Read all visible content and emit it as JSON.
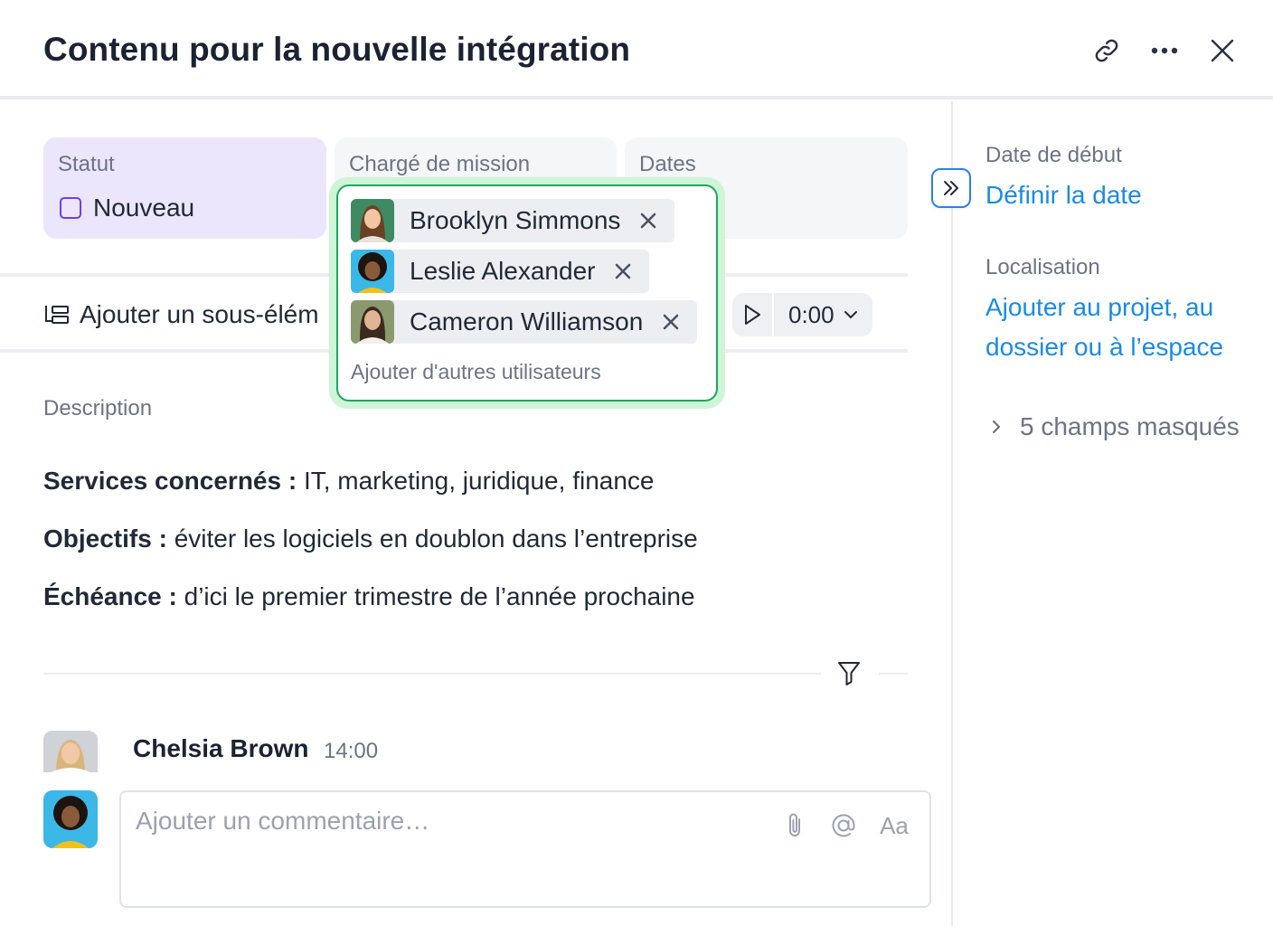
{
  "header": {
    "title": "Contenu pour la nouvelle intégration",
    "icons": [
      "link-icon",
      "more-icon",
      "close-icon"
    ]
  },
  "fields": {
    "status": {
      "label": "Statut",
      "value": "Nouveau",
      "color": "#6b3ef0"
    },
    "assignee": {
      "label": "Chargé de mission"
    },
    "dates": {
      "label": "Dates"
    }
  },
  "assignee_popup": {
    "users": [
      {
        "name": "Brooklyn Simmons"
      },
      {
        "name": "Leslie Alexander"
      },
      {
        "name": "Cameron Williamson"
      }
    ],
    "add_more": "Ajouter d'autres utilisateurs"
  },
  "toolbar": {
    "subitem_label": "Ajouter un sous-élém",
    "timer_value": "0:00"
  },
  "description": {
    "label": "Description",
    "lines": [
      {
        "bold": "Services concernés :",
        "text": " IT, marketing, juridique, finance"
      },
      {
        "bold": "Objectifs :",
        "text": " éviter les logiciels en doublon dans l’entreprise"
      },
      {
        "bold": "Échéance :",
        "text": " d’ici le premier trimestre de l’année prochaine"
      }
    ]
  },
  "activity": {
    "comment": {
      "author": "Chelsia Brown",
      "time": "14:00"
    },
    "input": {
      "placeholder": "Ajouter un commentaire…",
      "format_label": "Aa"
    }
  },
  "sidebar": {
    "start_date": {
      "label": "Date de début",
      "link": "Définir la date"
    },
    "location": {
      "label": "Localisation",
      "link_line1": "Ajouter au projet, au",
      "link_line2": "dossier ou à l’espace"
    },
    "hidden_fields": "5 champs masqués"
  },
  "colors": {
    "accent_link": "#1a8ae8",
    "status_bg": "#ebe6fb",
    "popup_border": "#25a45e",
    "popup_glow": "#cdf5d6"
  }
}
